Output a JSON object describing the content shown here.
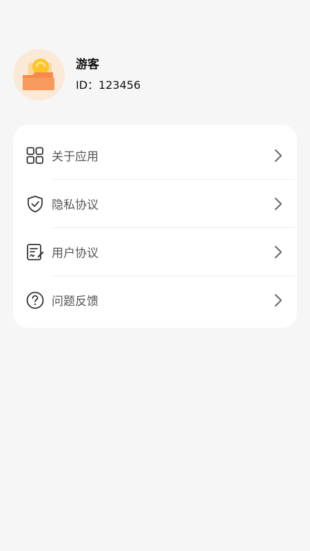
{
  "profile": {
    "name": "游客",
    "id_text": "ID：123456"
  },
  "menu": {
    "items": [
      {
        "label": "关于应用",
        "icon": "apps-grid-icon"
      },
      {
        "label": "隐私协议",
        "icon": "shield-check-icon"
      },
      {
        "label": "用户协议",
        "icon": "document-sign-icon"
      },
      {
        "label": "问题反馈",
        "icon": "help-circle-icon"
      }
    ]
  },
  "colors": {
    "background": "#f6f6f6",
    "card": "#ffffff",
    "avatar_bg": "#fbe9d8",
    "avatar_folder": "#f58a4b",
    "avatar_coin": "#f9c52a"
  }
}
